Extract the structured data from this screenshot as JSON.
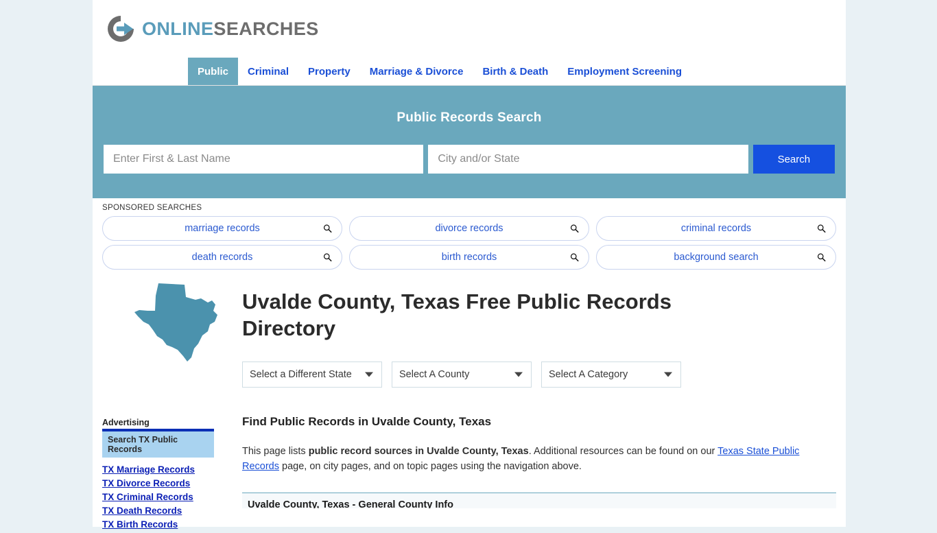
{
  "brand": {
    "logo_icon": "circular-arrow-icon",
    "name_part1": "ONLINE",
    "name_part2": "SEARCHES"
  },
  "nav": {
    "items": [
      {
        "label": "Public",
        "active": true
      },
      {
        "label": "Criminal",
        "active": false
      },
      {
        "label": "Property",
        "active": false
      },
      {
        "label": "Marriage & Divorce",
        "active": false
      },
      {
        "label": "Birth & Death",
        "active": false
      },
      {
        "label": "Employment Screening",
        "active": false
      }
    ]
  },
  "search": {
    "title": "Public Records Search",
    "name_placeholder": "Enter First & Last Name",
    "name_value": "",
    "location_placeholder": "City and/or State",
    "location_value": "",
    "button_label": "Search"
  },
  "sponsored": {
    "label": "SPONSORED SEARCHES",
    "items": [
      {
        "label": "marriage records"
      },
      {
        "label": "divorce records"
      },
      {
        "label": "criminal records"
      },
      {
        "label": "death records"
      },
      {
        "label": "birth records"
      },
      {
        "label": "background search"
      }
    ]
  },
  "hero": {
    "state_map_icon": "texas-state-map-icon",
    "title": "Uvalde County, Texas Free Public Records Directory"
  },
  "selects": [
    {
      "value": "Select a Different State"
    },
    {
      "value": "Select A County"
    },
    {
      "value": "Select A Category"
    }
  ],
  "main": {
    "section_heading": "Find Public Records in Uvalde County, Texas",
    "paragraph_start": "This page lists ",
    "paragraph_bold": "public record sources in Uvalde County, Texas",
    "paragraph_mid": ". Additional resources can be found on our ",
    "paragraph_link": "Texas State Public Records",
    "paragraph_end": " page, on city pages, and on topic pages using the navigation above.",
    "table_heading": "Uvalde County, Texas - General County Info"
  },
  "sidebar": {
    "ad_label": "Advertising",
    "cta_label": "Search TX Public Records",
    "links": [
      {
        "label": "TX Marriage Records"
      },
      {
        "label": "TX Divorce Records"
      },
      {
        "label": "TX Criminal Records"
      },
      {
        "label": "TX Death Records"
      },
      {
        "label": "TX Birth Records"
      }
    ]
  },
  "colors": {
    "band_teal": "#6aa8bd",
    "link_blue": "#1a4fd6",
    "button_blue": "#1550e0",
    "page_bg": "#e9f1f5"
  }
}
